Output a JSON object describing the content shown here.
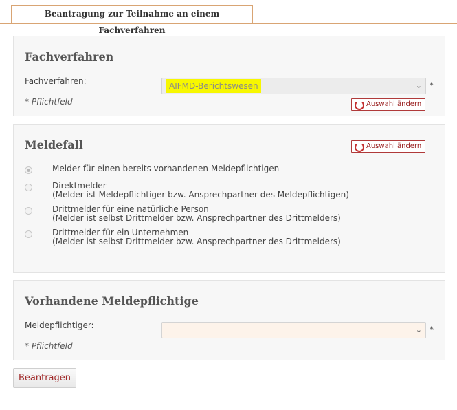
{
  "tab": {
    "label": "Beantragung zur Teilnahme an einem Fachverfahren"
  },
  "fachverfahren": {
    "title": "Fachverfahren",
    "field_label": "Fachverfahren:",
    "selected": "AIFMD-Berichtswesen",
    "required_mark": "*",
    "required_note": "* Pflichtfeld",
    "change_button": "Auswahl ändern"
  },
  "meldefall": {
    "title": "Meldefall",
    "change_button": "Auswahl ändern",
    "options": [
      {
        "line1": "Melder für einen bereits vorhandenen Meldepflichtigen",
        "line2": "",
        "selected": true
      },
      {
        "line1": "Direktmelder",
        "line2": "(Melder ist Meldepflichtiger bzw. Ansprechpartner des Meldepflichtigen)",
        "selected": false
      },
      {
        "line1": "Drittmelder für eine natürliche Person",
        "line2": "(Melder ist selbst Drittmelder bzw. Ansprechpartner des Drittmelders)",
        "selected": false
      },
      {
        "line1": "Drittmelder für ein Unternehmen",
        "line2": "(Melder ist selbst Drittmelder bzw. Ansprechpartner des Drittmelders)",
        "selected": false
      }
    ]
  },
  "meldepflichtige": {
    "title": "Vorhandene Meldepflichtige",
    "field_label": "Meldepflichtiger:",
    "selected": "",
    "required_mark": "*",
    "required_note": "* Pflichtfeld"
  },
  "submit_label": "Beantragen",
  "colors": {
    "accent": "#d9a574",
    "button_text": "#a02828",
    "highlight": "#f7f700",
    "select_bg_required": "#fdf3ea"
  }
}
